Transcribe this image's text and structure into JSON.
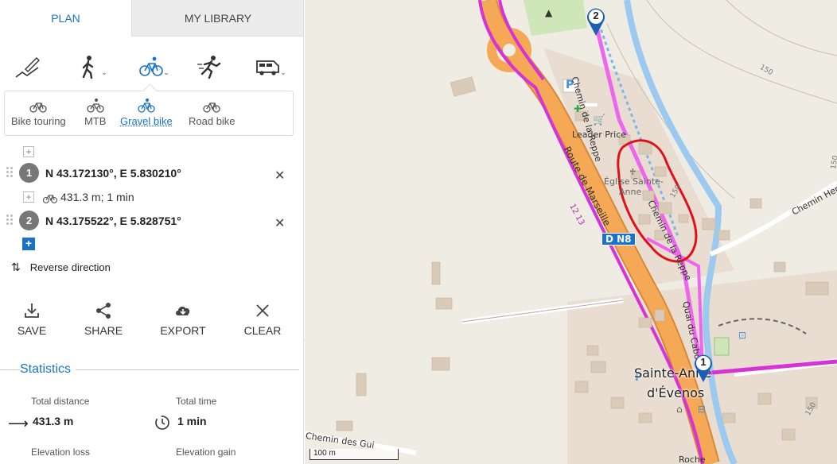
{
  "tabs": {
    "plan": "PLAN",
    "library": "MY LIBRARY"
  },
  "modes": [
    "draw-route",
    "hiking",
    "cycling",
    "running",
    "car"
  ],
  "submodes": [
    {
      "label": "Bike touring"
    },
    {
      "label": "MTB"
    },
    {
      "label": "Gravel bike"
    },
    {
      "label": "Road bike"
    }
  ],
  "waypoints": [
    {
      "number": "1",
      "coords": "N 43.172130°, E 5.830210°"
    },
    {
      "number": "2",
      "coords": "N 43.175522°, E 5.828751°"
    }
  ],
  "segment": "431.3 m; 1 min",
  "reverse": "Reverse direction",
  "actions": {
    "save": "SAVE",
    "share": "SHARE",
    "export": "EXPORT",
    "clear": "CLEAR"
  },
  "stats": {
    "title": "Statistics",
    "distance_label": "Total distance",
    "distance_value": "431.3 m",
    "time_label": "Total time",
    "time_value": "1 min",
    "loss_label": "Elevation loss",
    "gain_label": "Elevation gain"
  },
  "map": {
    "labels": {
      "leader_price": "Leader Price",
      "eglise_1": "Église Sainte-",
      "eglise_2": "Anne",
      "chemin_reppe_top": "Chemin de la Reppe",
      "chemin_reppe_mid": "Chemin de la Reppe",
      "route_marseille": "Route de Marseille",
      "route_num": "12 13",
      "dn8": "D N8",
      "quai": "Quai du Cabo",
      "chemin_henri": "Chemin Henri",
      "town_1": "Sainte-Anne",
      "town_2": "d'Évenos",
      "chemin_gui": "Chemin des Gui",
      "roche": "Roche",
      "contour_150_a": "150",
      "contour_150_b": "150",
      "contour_150_c": "150",
      "contour_150_d": "150",
      "scale": "100 m"
    },
    "pins": [
      "2",
      "1"
    ],
    "colors": {
      "route": "#d633d6",
      "road_major": "#f5a855",
      "river": "#7ab8e8",
      "annotation": "#e0101a",
      "accent": "#1a73c8"
    }
  }
}
